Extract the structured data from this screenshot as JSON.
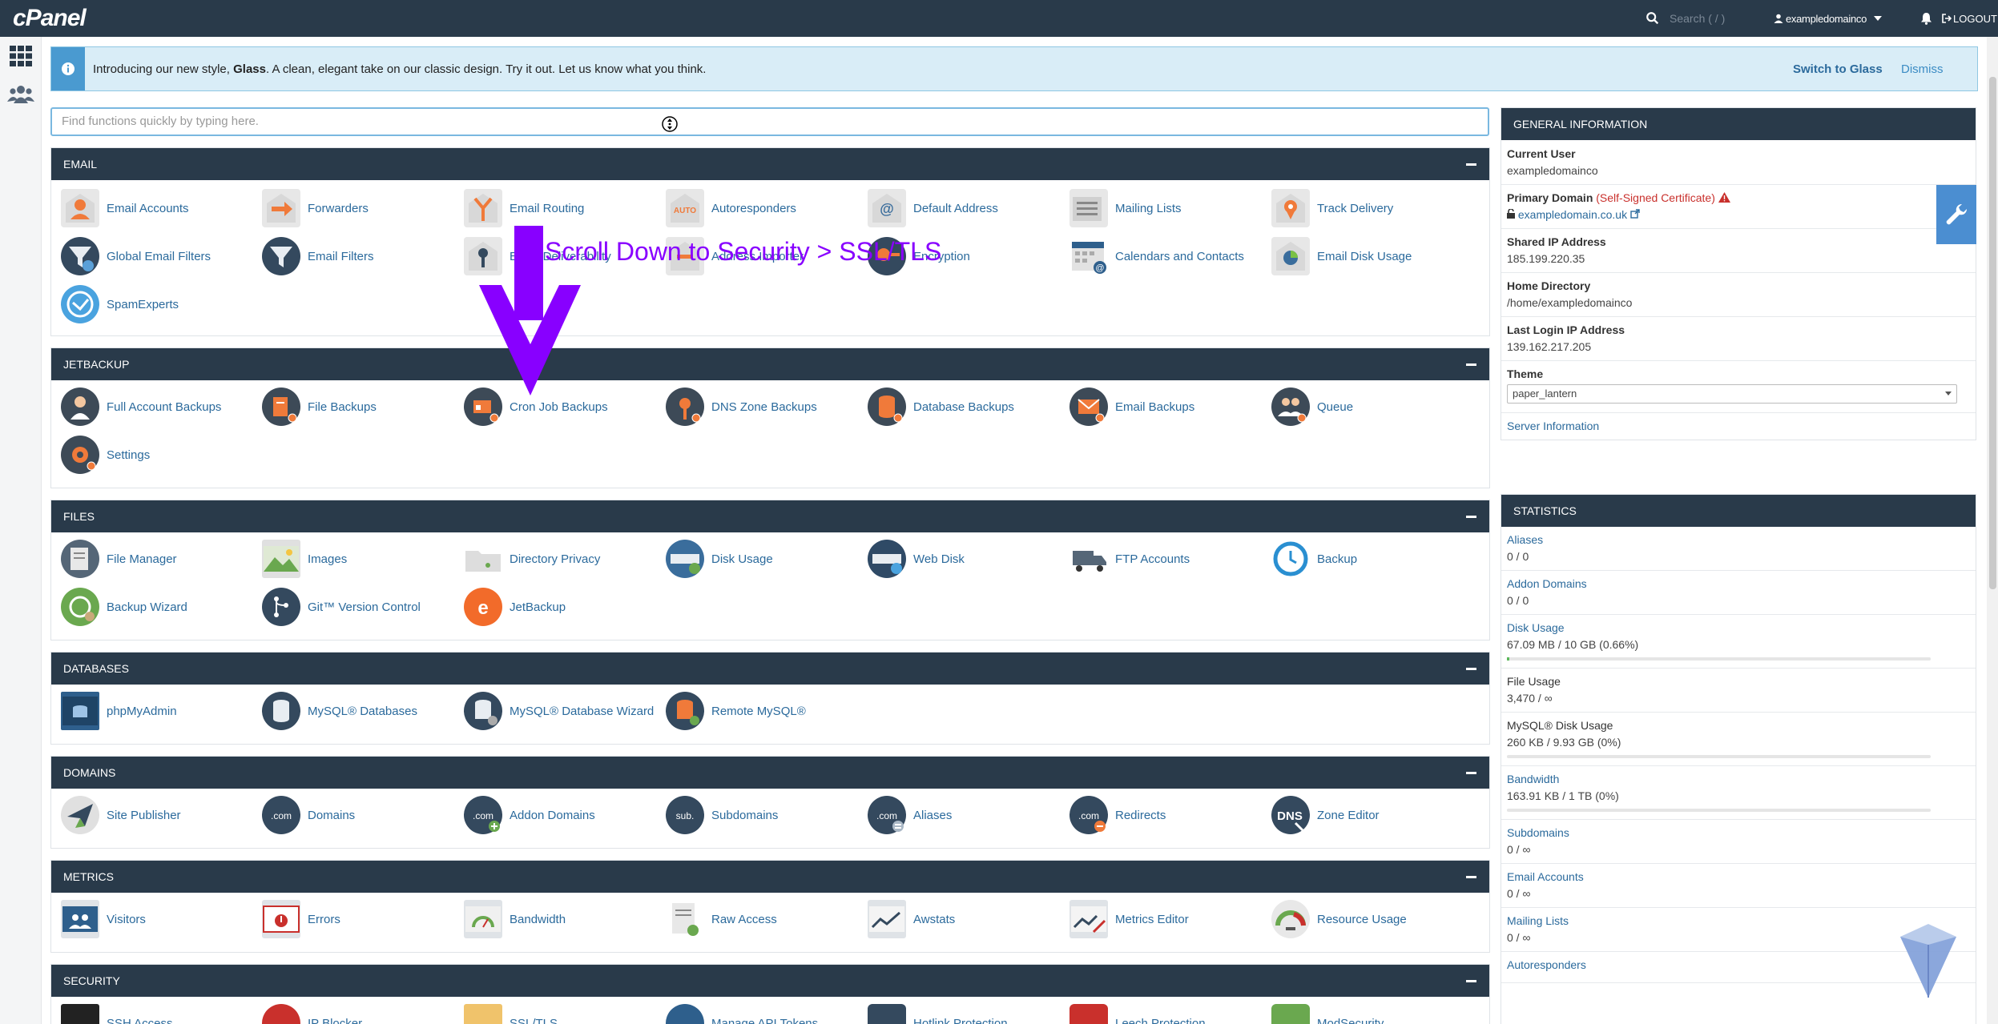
{
  "topbar": {
    "logo": "cPanel",
    "search_placeholder": "Search ( / )",
    "username": "exampledomainco",
    "logout_label": "LOGOUT"
  },
  "notice": {
    "intro": "Introducing our new style,",
    "glass": "Glass",
    "rest": ". A clean, elegant take on our classic design. Try it out. Let us know what you think.",
    "switch_label": "Switch to Glass",
    "dismiss_label": "Dismiss"
  },
  "quickfind": {
    "placeholder": "Find functions quickly by typing here."
  },
  "annotation": {
    "text": "Scroll Down to Security > SSL/TLS"
  },
  "sections": {
    "email": {
      "title": "EMAIL",
      "items": [
        "Email Accounts",
        "Forwarders",
        "Email Routing",
        "Autoresponders",
        "Default Address",
        "Mailing Lists",
        "Track Delivery",
        "Global Email Filters",
        "Email Filters",
        "Email Deliverability",
        "Address Importer",
        "Encryption",
        "Calendars and Contacts",
        "Email Disk Usage",
        "SpamExperts"
      ]
    },
    "jetbackup": {
      "title": "JETBACKUP",
      "items": [
        "Full Account Backups",
        "File Backups",
        "Cron Job Backups",
        "DNS Zone Backups",
        "Database Backups",
        "Email Backups",
        "Queue",
        "Settings"
      ]
    },
    "files": {
      "title": "FILES",
      "items": [
        "File Manager",
        "Images",
        "Directory Privacy",
        "Disk Usage",
        "Web Disk",
        "FTP Accounts",
        "Backup",
        "Backup Wizard",
        "Git™ Version Control",
        "JetBackup"
      ]
    },
    "databases": {
      "title": "DATABASES",
      "items": [
        "phpMyAdmin",
        "MySQL® Databases",
        "MySQL® Database Wizard",
        "Remote MySQL®"
      ]
    },
    "domains": {
      "title": "DOMAINS",
      "items": [
        "Site Publisher",
        "Domains",
        "Addon Domains",
        "Subdomains",
        "Aliases",
        "Redirects",
        "Zone Editor"
      ]
    },
    "metrics": {
      "title": "METRICS",
      "items": [
        "Visitors",
        "Errors",
        "Bandwidth",
        "Raw Access",
        "Awstats",
        "Metrics Editor",
        "Resource Usage"
      ]
    },
    "security": {
      "title": "SECURITY",
      "items": [
        "SSH Access",
        "IP Blocker",
        "SSL/TLS",
        "Manage API Tokens",
        "Hotlink Protection",
        "Leech Protection",
        "ModSecurity"
      ]
    }
  },
  "general_info": {
    "title": "GENERAL INFORMATION",
    "current_user_label": "Current User",
    "current_user": "exampledomainco",
    "primary_domain_label": "Primary Domain",
    "cert_status": "(Self-Signed Certificate)",
    "primary_domain": "exampledomain.co.uk",
    "shared_ip_label": "Shared IP Address",
    "shared_ip": "185.199.220.35",
    "home_dir_label": "Home Directory",
    "home_dir": "/home/exampledomainco",
    "last_login_label": "Last Login IP Address",
    "last_login": "139.162.217.205",
    "theme_label": "Theme",
    "theme_value": "paper_lantern",
    "server_info_link": "Server Information"
  },
  "statistics": {
    "title": "STATISTICS",
    "rows": [
      {
        "label": "Aliases",
        "value": "0 / 0",
        "link": true
      },
      {
        "label": "Addon Domains",
        "value": "0 / 0",
        "link": true
      },
      {
        "label": "Disk Usage",
        "value": "67.09 MB / 10 GB   (0.66%)",
        "link": true,
        "fraction": 0.0066
      },
      {
        "label": "File Usage",
        "value": "3,470 / ∞",
        "link": false
      },
      {
        "label": "MySQL® Disk Usage",
        "value": "260 KB / 9.93 GB   (0%)",
        "link": false,
        "fraction": 0
      },
      {
        "label": "Bandwidth",
        "value": "163.91 KB / 1 TB   (0%)",
        "link": true,
        "fraction": 0
      },
      {
        "label": "Subdomains",
        "value": "0 / ∞",
        "link": true
      },
      {
        "label": "Email Accounts",
        "value": "0 / ∞",
        "link": true
      },
      {
        "label": "Mailing Lists",
        "value": "0 / ∞",
        "link": true
      },
      {
        "label": "Autoresponders",
        "value": "",
        "link": true
      }
    ]
  },
  "colors": {
    "header": "#293a4a",
    "link": "#2b6a9c",
    "annotation": "#8800ff"
  }
}
